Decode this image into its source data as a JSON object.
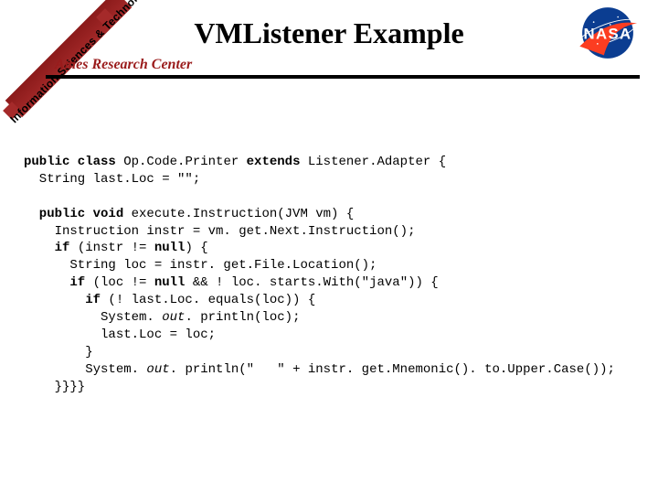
{
  "header": {
    "title": "VMListener Example",
    "center_name": "Ames Research Center",
    "ribbon_text": "Information Sciences & Technology",
    "nasa_wordmark": "NASA"
  },
  "logo": {
    "name": "nasa-meatball",
    "bg_color": "#0b3d91",
    "swoosh_color": "#fc3d21",
    "text_color": "#ffffff"
  },
  "code": {
    "l1a": "public class",
    "l1b": " Op.Code.Printer ",
    "l1c": "extends",
    "l1d": " Listener.Adapter {",
    "l2": "  String last.Loc = \"\";",
    "blank1": " ",
    "l3a": "  public void",
    "l3b": " execute.Instruction(JVM vm) {",
    "l4": "    Instruction instr = vm. get.Next.Instruction();",
    "l5a": "    if",
    "l5b": " (instr != ",
    "l5c": "null",
    "l5d": ") {",
    "l6": "      String loc = instr. get.File.Location();",
    "l7a": "      if",
    "l7b": " (loc != ",
    "l7c": "null",
    "l7d": " && ! loc. starts.With(\"java\")) {",
    "l8a": "        if",
    "l8b": " (! last.Loc. equals(loc)) {",
    "l9a": "          System. ",
    "l9b": "out",
    "l9c": ". println(loc);",
    "l10": "          last.Loc = loc;",
    "l11": "        }",
    "l12a": "        System. ",
    "l12b": "out",
    "l12c": ". println(\"   \" + instr. get.Mnemonic(). to.Upper.Case());",
    "l13": "    }}}}"
  }
}
